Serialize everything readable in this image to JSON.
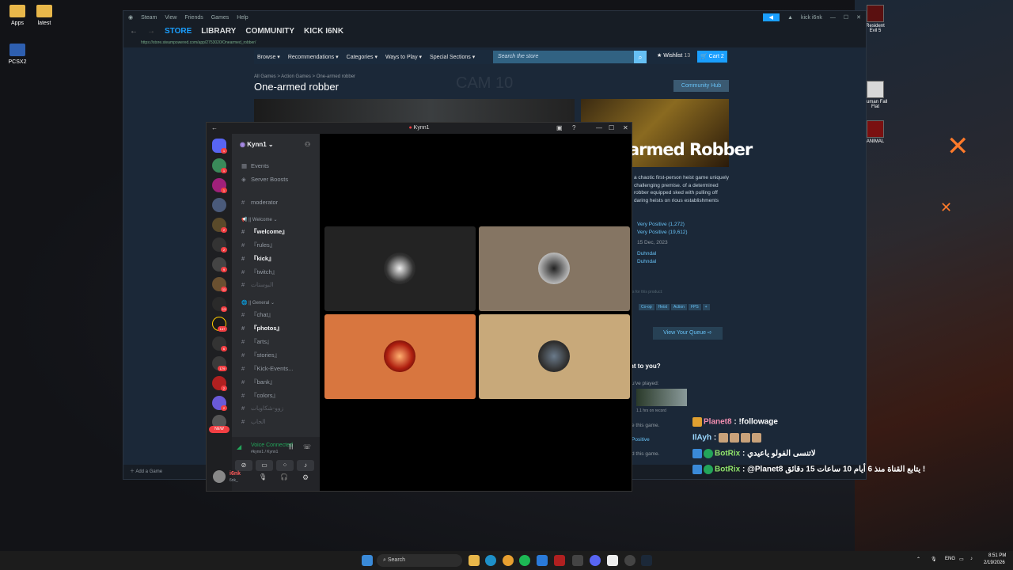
{
  "desktop": {
    "icons": [
      "Apps",
      "latest",
      "PCSX2"
    ],
    "right_icons": [
      "Resident Evil 5",
      "Human Fall Flat",
      "ANIMAL"
    ]
  },
  "steam": {
    "title": "Steam",
    "menu": [
      "View",
      "Friends",
      "Games",
      "Help"
    ],
    "nav": [
      "STORE",
      "LIBRARY",
      "COMMUNITY",
      "KICK I6NK"
    ],
    "url": "https://store.steampowered.com/app/2753020/Onearmed_robber/",
    "account": "kick i6nk",
    "store_nav": [
      "Browse",
      "Recommendations",
      "Categories",
      "Ways to Play",
      "Special Sections"
    ],
    "search_placeholder": "Search the store",
    "wishlist": "Wishlist",
    "wishlist_count": "13",
    "cart": "Cart",
    "cart_count": "2",
    "breadcrumb": "All Games > Action Games > One-armed robber",
    "game_title": "One-armed robber",
    "community_hub": "Community Hub",
    "watermark": "CAM 10",
    "capsule_title": "armed Robber",
    "description": "a chaotic first-person heist game uniquely challenging premise. of a determined robber equipped sked with pulling off daring heists on rious establishments",
    "recent_reviews": "Very Positive (1,272)",
    "all_reviews": "Very Positive (19,612)",
    "release_date": "15 Dec, 2023",
    "developer": "Duhndal",
    "publisher": "Duhndal",
    "tags_label": "s for this product:",
    "tags": [
      "Co-op",
      "Heist",
      "Action",
      "FPS",
      "+"
    ],
    "view_queue": "View Your Queue",
    "relevant": "nt to you?",
    "played_label": "u've played:",
    "played_hours": "1.1 hrs on record",
    "game_label1": "e this game.",
    "rating_label": "Positive",
    "game_label2": "d this game.",
    "add_game": "Add a Game"
  },
  "discord": {
    "window_title": "Kynn1",
    "server_name": "Kynn1",
    "top_items": [
      "Events",
      "Server Boosts",
      "moderator"
    ],
    "category_welcome": "|| Welcome",
    "welcome_channels": [
      "『welcome』",
      "『rules』",
      "『kick』",
      "『twitch』",
      "البوستات"
    ],
    "category_general": "|| General",
    "general_channels": [
      "『chat』",
      "『photos』",
      "『arts』",
      "『stories』",
      "『Kick-Events...",
      "『bank』",
      "『colors』",
      "زوو-شكاويات",
      "الحاب"
    ],
    "guild_badges": [
      "1",
      "1",
      "1",
      "2",
      "2",
      "9",
      "11",
      "13",
      "147",
      "6",
      "179",
      "2",
      "2"
    ],
    "new_badge": "NEW",
    "voice_status": "Voice Connected",
    "voice_channel": "#kynn1 / Kynn1",
    "username": "i6nk",
    "user_status": "6nk_"
  },
  "chat": {
    "lines": [
      {
        "name": "Planet8",
        "message": " : !followage"
      },
      {
        "name": "IlAyh",
        "message": " : "
      },
      {
        "name": "BotRix",
        "message": " : لاتنسى الفولو ياعيدي"
      },
      {
        "name": "BotRix",
        "message": " : @Planet8 يتابع القناة منذ 6 أيام 10 ساعات 15 دقائق !"
      }
    ]
  },
  "taskbar": {
    "search": "Search",
    "lang": "ENG",
    "time": "8:51 PM",
    "date": "2/19/2026"
  },
  "colors": {
    "steam_bg": "#1b2838",
    "steam_accent": "#1a9fff",
    "discord_bg": "#2b2d31",
    "voice_green": "#23a55a",
    "tile_dark": "#232323",
    "tile_taupe": "#857563",
    "tile_orange": "#d8763f",
    "tile_sand": "#c8a97a"
  }
}
